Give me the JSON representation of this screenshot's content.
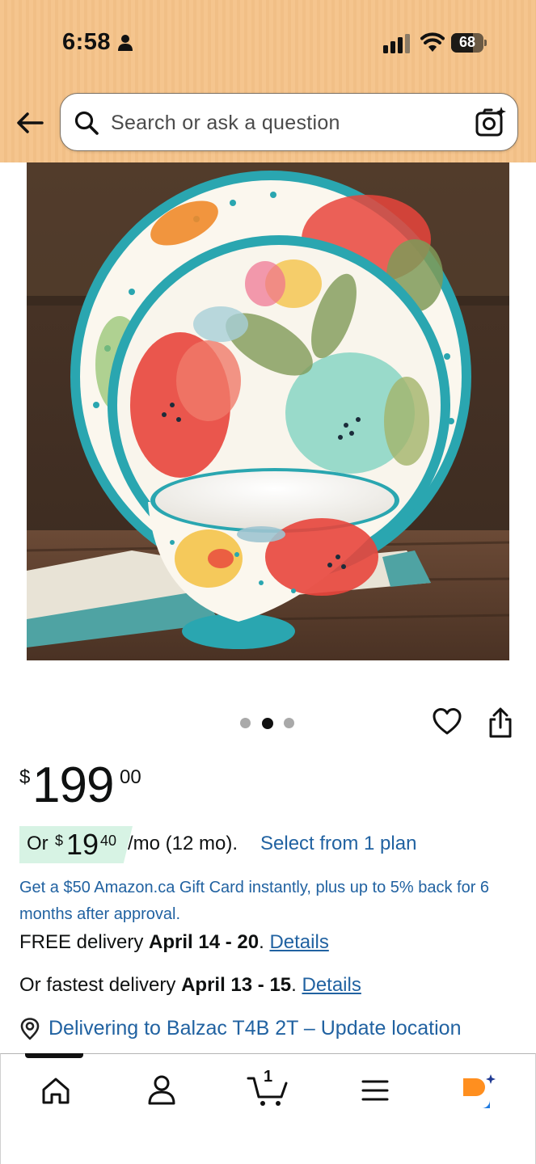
{
  "status_bar": {
    "time": "6:58",
    "battery": "68"
  },
  "header": {
    "search_placeholder": "Search or ask a question"
  },
  "carousel": {
    "image_count": 3,
    "active_index": 1
  },
  "price": {
    "symbol": "$",
    "whole": "199",
    "fraction": "00"
  },
  "installment": {
    "or_label": "Or",
    "symbol": "$",
    "whole": "19",
    "fraction": "40",
    "term": "/mo (12 mo).",
    "link": "Select from 1 plan"
  },
  "gift_card": "Get a $50 Amazon.ca Gift Card instantly, plus up to 5% back for 6 months after approval.",
  "delivery": {
    "free_prefix": "FREE delivery",
    "free_dates": "April 14 - 20",
    "free_suffix": ".",
    "free_link": "Details",
    "fast_prefix": "Or fastest delivery",
    "fast_dates": "April 13 - 15",
    "fast_suffix": ".",
    "fast_link": "Details"
  },
  "location": "Delivering to Balzac T4B 2T – Update location",
  "bottom_nav": {
    "cart_count": "1",
    "items": [
      "home-icon",
      "account-icon",
      "cart-icon",
      "menu-icon",
      "rufus-ai-icon"
    ]
  },
  "colors": {
    "header_bg": "#f5c58e",
    "link": "#2162a1",
    "installment_badge": "#d7f3e4",
    "ai_orange": "#ff8f1f",
    "ai_blue": "#1f7ae0"
  }
}
